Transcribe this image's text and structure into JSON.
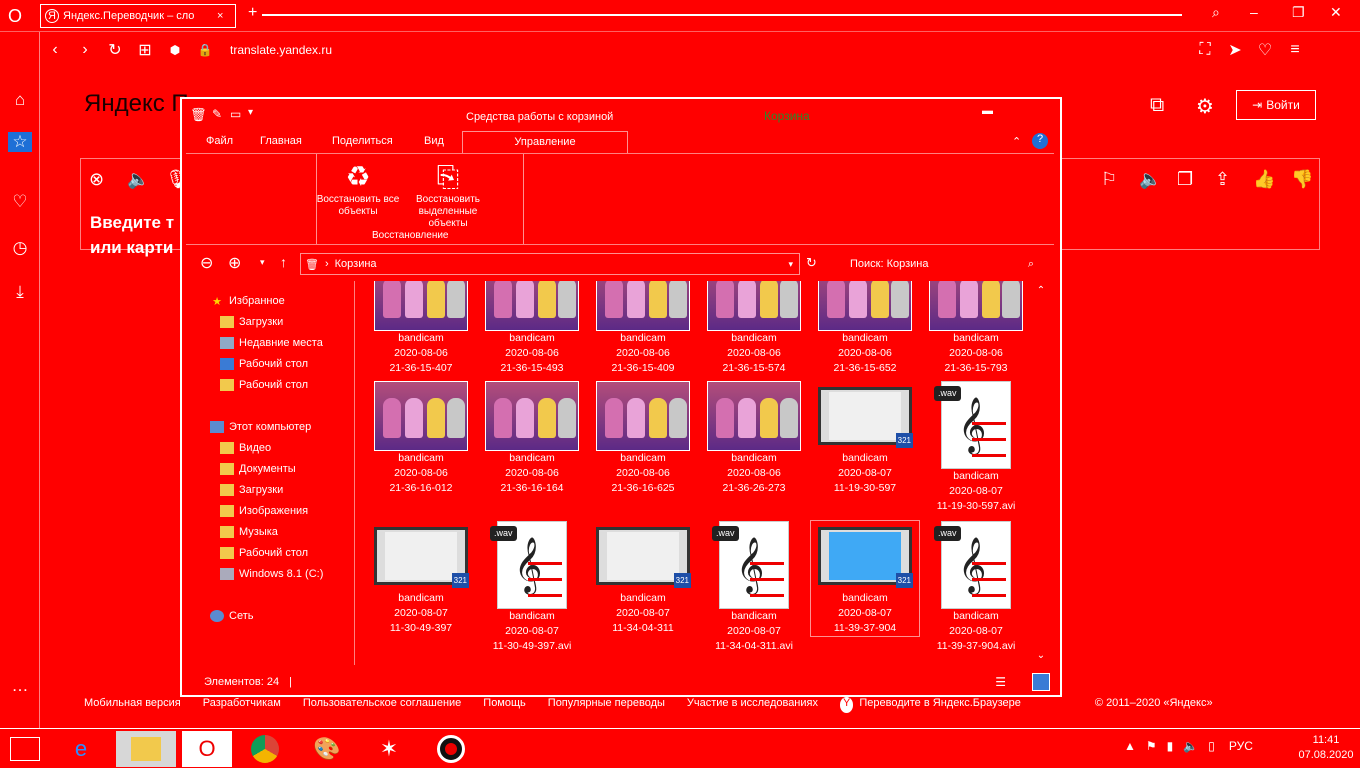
{
  "browser": {
    "tab_title": "Яндекс.Переводчик – сло",
    "tab_close": "×",
    "new_tab": "+",
    "url": "translate.yandex.ru"
  },
  "page": {
    "logo": "Яндекс Переводчик",
    "login": "Войти",
    "placeholder_line1": "Введите т",
    "placeholder_line2": "или карти",
    "footer": [
      "Мобильная версия",
      "Разработчикам",
      "Пользовательское соглашение",
      "Помощь",
      "Популярные переводы",
      "Участие в исследованиях"
    ],
    "browser_link": "Переводите в Яндекс.Браузере",
    "copyright": "© 2011–2020 «Яндекс»"
  },
  "explorer": {
    "context_title": "Средства работы с корзиной",
    "window_title": "Корзина",
    "tabs": [
      "Файл",
      "Главная",
      "Поделиться",
      "Вид",
      "Управление"
    ],
    "ribbon_buttons": [
      {
        "label": "Восстановить все объекты"
      },
      {
        "label": "Восстановить выделенные объекты"
      }
    ],
    "ribbon_group": "Восстановление",
    "address": "Корзина",
    "search_placeholder": "Поиск: Корзина",
    "tree": {
      "favorites": "Избранное",
      "fav_items": [
        "Загрузки",
        "Недавние места",
        "Рабочий стол",
        "Рабочий стол"
      ],
      "computer": "Этот компьютер",
      "comp_items": [
        "Видео",
        "Документы",
        "Загрузки",
        "Изображения",
        "Музыка",
        "Рабочий стол",
        "Windows 8.1 (C:)"
      ],
      "network": "Сеть"
    },
    "items": [
      {
        "kind": "game",
        "name": "bandicam",
        "date": "2020-08-06",
        "time": "21-36-15-407"
      },
      {
        "kind": "game",
        "name": "bandicam",
        "date": "2020-08-06",
        "time": "21-36-15-493"
      },
      {
        "kind": "game",
        "name": "bandicam",
        "date": "2020-08-06",
        "time": "21-36-15-409"
      },
      {
        "kind": "game",
        "name": "bandicam",
        "date": "2020-08-06",
        "time": "21-36-15-574"
      },
      {
        "kind": "game",
        "name": "bandicam",
        "date": "2020-08-06",
        "time": "21-36-15-652"
      },
      {
        "kind": "game",
        "name": "bandicam",
        "date": "2020-08-06",
        "time": "21-36-15-793"
      },
      {
        "kind": "game",
        "name": "bandicam",
        "date": "2020-08-06",
        "time": "21-36-16-012"
      },
      {
        "kind": "game",
        "name": "bandicam",
        "date": "2020-08-06",
        "time": "21-36-16-164"
      },
      {
        "kind": "game",
        "name": "bandicam",
        "date": "2020-08-06",
        "time": "21-36-16-625"
      },
      {
        "kind": "game",
        "name": "bandicam",
        "date": "2020-08-06",
        "time": "21-36-26-273"
      },
      {
        "kind": "video",
        "name": "bandicam",
        "date": "2020-08-07",
        "time": "11-19-30-597"
      },
      {
        "kind": "wav",
        "name": "bandicam",
        "date": "2020-08-07",
        "time": "11-19-30-597.avi"
      },
      {
        "kind": "video",
        "name": "bandicam",
        "date": "2020-08-07",
        "time": "11-30-49-397"
      },
      {
        "kind": "wav",
        "name": "bandicam",
        "date": "2020-08-07",
        "time": "11-30-49-397.avi"
      },
      {
        "kind": "video",
        "name": "bandicam",
        "date": "2020-08-07",
        "time": "11-34-04-311"
      },
      {
        "kind": "wav",
        "name": "bandicam",
        "date": "2020-08-07",
        "time": "11-34-04-311.avi"
      },
      {
        "kind": "video2",
        "name": "bandicam",
        "date": "2020-08-07",
        "time": "11-39-37-904"
      },
      {
        "kind": "wav",
        "name": "bandicam",
        "date": "2020-08-07",
        "time": "11-39-37-904.avi"
      }
    ],
    "wav_label": ".wav",
    "video_badge": "321",
    "status": "Элементов: 24"
  },
  "taskbar": {
    "lang": "РУС",
    "time": "11:41",
    "date": "07.08.2020"
  }
}
